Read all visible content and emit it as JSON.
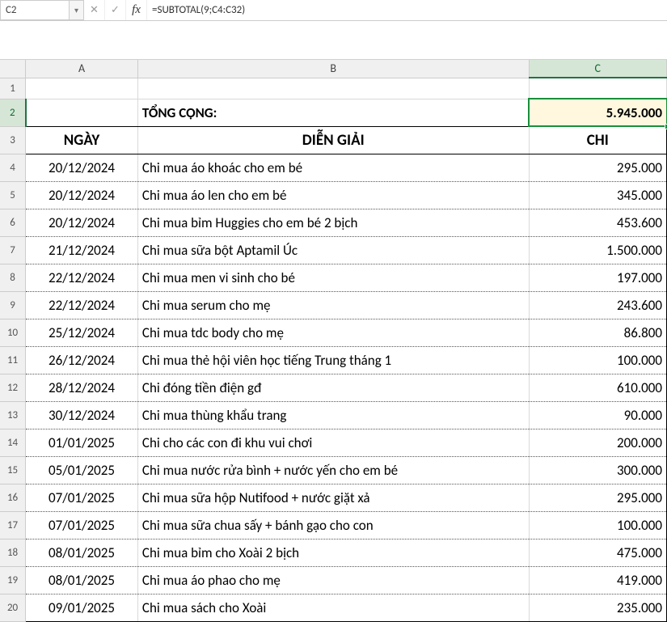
{
  "formulaBar": {
    "nameBox": "C2",
    "cancelGlyph": "✕",
    "acceptGlyph": "✓",
    "fxGlyph": "fx",
    "formula": "=SUBTOTAL(9;C4:C32)"
  },
  "columns": {
    "A": "A",
    "B": "B",
    "C": "C"
  },
  "rowNumbers": [
    "1",
    "2",
    "3",
    "4",
    "5",
    "6",
    "7",
    "8",
    "9",
    "10",
    "11",
    "12",
    "13",
    "14",
    "15",
    "16",
    "17",
    "18",
    "19",
    "20"
  ],
  "header": {
    "totalLabel": "TỔNG CỘNG:",
    "totalValue": "5.945.000",
    "colA": "NGÀY",
    "colB": "DIỄN GIẢI",
    "colC": "CHI"
  },
  "rows": [
    {
      "date": "20/12/2024",
      "desc": "Chi mua áo khoác cho em bé",
      "amount": "295.000"
    },
    {
      "date": "20/12/2024",
      "desc": "Chi mua áo len cho em bé",
      "amount": "345.000"
    },
    {
      "date": "20/12/2024",
      "desc": "Chi mua bỉm Huggies cho em bé 2 bịch",
      "amount": "453.600"
    },
    {
      "date": "21/12/2024",
      "desc": "Chi mua sữa bột Aptamil Úc",
      "amount": "1.500.000"
    },
    {
      "date": "22/12/2024",
      "desc": "Chi mua men vi sinh cho bé",
      "amount": "197.000"
    },
    {
      "date": "22/12/2024",
      "desc": "Chi mua serum cho mẹ",
      "amount": "243.600"
    },
    {
      "date": "25/12/2024",
      "desc": "Chi mua tdc body cho mẹ",
      "amount": "86.800"
    },
    {
      "date": "26/12/2024",
      "desc": "Chi mua thẻ hội viên học tiếng Trung tháng 1",
      "amount": "100.000"
    },
    {
      "date": "28/12/2024",
      "desc": "Chi đóng tiền điện gđ",
      "amount": "610.000"
    },
    {
      "date": "30/12/2024",
      "desc": "Chi mua thùng khẩu trang",
      "amount": "90.000"
    },
    {
      "date": "01/01/2025",
      "desc": "Chi cho các con đi khu vui chơi",
      "amount": "200.000"
    },
    {
      "date": "05/01/2025",
      "desc": "Chi mua nước rửa bình + nước yến cho em bé",
      "amount": "300.000"
    },
    {
      "date": "07/01/2025",
      "desc": "Chi mua sữa hộp Nutifood  + nước giặt xả",
      "amount": "295.000"
    },
    {
      "date": "07/01/2025",
      "desc": "Chi mua sữa chua sấy + bánh gạo cho con",
      "amount": "100.000"
    },
    {
      "date": "08/01/2025",
      "desc": "Chi mua bỉm cho Xoài 2 bịch",
      "amount": "475.000"
    },
    {
      "date": "08/01/2025",
      "desc": "Chi mua áo phao cho mẹ",
      "amount": "419.000"
    },
    {
      "date": "09/01/2025",
      "desc": "Chi mua sách cho Xoài",
      "amount": "235.000"
    }
  ],
  "selection": {
    "activeCellName": "C2",
    "row": 2,
    "col": "C"
  },
  "chart_data": {
    "type": "table",
    "title": "TỔNG CỘNG: 5.945.000",
    "columns": [
      "NGÀY",
      "DIỄN GIẢI",
      "CHI"
    ],
    "rows": [
      [
        "20/12/2024",
        "Chi mua áo khoác cho em bé",
        295000
      ],
      [
        "20/12/2024",
        "Chi mua áo len cho em bé",
        345000
      ],
      [
        "20/12/2024",
        "Chi mua bỉm Huggies cho em bé 2 bịch",
        453600
      ],
      [
        "21/12/2024",
        "Chi mua sữa bột Aptamil Úc",
        1500000
      ],
      [
        "22/12/2024",
        "Chi mua men vi sinh cho bé",
        197000
      ],
      [
        "22/12/2024",
        "Chi mua serum cho mẹ",
        243600
      ],
      [
        "25/12/2024",
        "Chi mua tdc body cho mẹ",
        86800
      ],
      [
        "26/12/2024",
        "Chi mua thẻ hội viên học tiếng Trung tháng 1",
        100000
      ],
      [
        "28/12/2024",
        "Chi đóng tiền điện gđ",
        610000
      ],
      [
        "30/12/2024",
        "Chi mua thùng khẩu trang",
        90000
      ],
      [
        "01/01/2025",
        "Chi cho các con đi khu vui chơi",
        200000
      ],
      [
        "05/01/2025",
        "Chi mua nước rửa bình + nước yến cho em bé",
        300000
      ],
      [
        "07/01/2025",
        "Chi mua sữa hộp Nutifood  + nước giặt xả",
        295000
      ],
      [
        "07/01/2025",
        "Chi mua sữa chua sấy + bánh gạo cho con",
        100000
      ],
      [
        "08/01/2025",
        "Chi mua bỉm cho Xoài 2 bịch",
        475000
      ],
      [
        "08/01/2025",
        "Chi mua áo phao cho mẹ",
        419000
      ],
      [
        "09/01/2025",
        "Chi mua sách cho Xoài",
        235000
      ]
    ]
  }
}
